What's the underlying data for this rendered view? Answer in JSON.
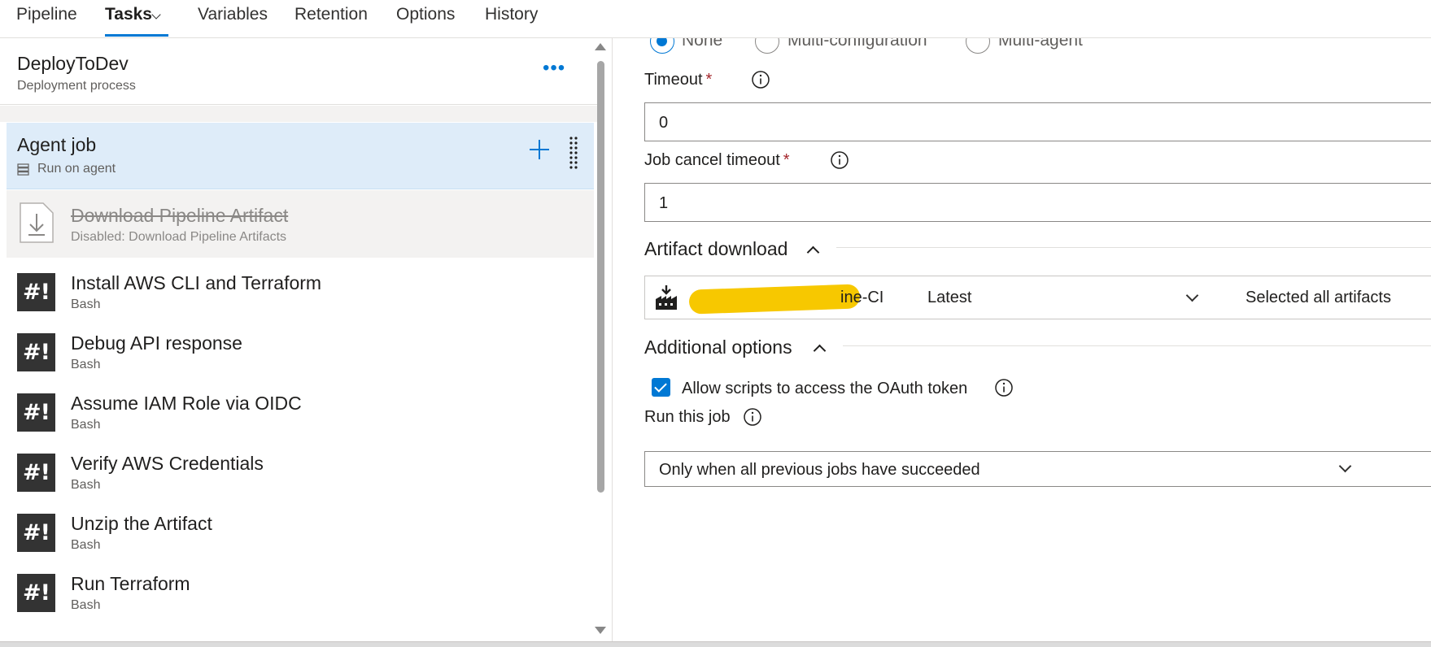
{
  "nav": {
    "tabs": [
      {
        "label": "Pipeline"
      },
      {
        "label": "Tasks"
      },
      {
        "label": "Variables"
      },
      {
        "label": "Retention"
      },
      {
        "label": "Options"
      },
      {
        "label": "History"
      }
    ],
    "active_tab": "Tasks",
    "accent_color": "#0078d4"
  },
  "stage": {
    "title": "DeployToDev",
    "subtitle": "Deployment process",
    "more_label": "•••"
  },
  "agent_job": {
    "title": "Agent job",
    "subtitle": "Run on agent"
  },
  "tasks": [
    {
      "name": "Download Pipeline Artifact",
      "subtitle": "Disabled: Download Pipeline Artifacts",
      "icon": "download-icon",
      "disabled": true
    },
    {
      "name": "Install AWS CLI and Terraform",
      "subtitle": "Bash",
      "icon": "bash-icon",
      "glyph": "#!"
    },
    {
      "name": "Debug API response",
      "subtitle": "Bash",
      "icon": "bash-icon",
      "glyph": "#!"
    },
    {
      "name": "Assume IAM Role via OIDC",
      "subtitle": "Bash",
      "icon": "bash-icon",
      "glyph": "#!"
    },
    {
      "name": "Verify AWS Credentials",
      "subtitle": "Bash",
      "icon": "bash-icon",
      "glyph": "#!"
    },
    {
      "name": "Unzip the Artifact",
      "subtitle": "Bash",
      "icon": "bash-icon",
      "glyph": "#!"
    },
    {
      "name": "Run Terraform",
      "subtitle": "Bash",
      "icon": "bash-icon",
      "glyph": "#!"
    }
  ],
  "parallelism": {
    "options": [
      "None",
      "Multi-configuration",
      "Multi-agent"
    ],
    "selected": "None"
  },
  "timeout": {
    "label": "Timeout",
    "required_mark": "*",
    "value": "0"
  },
  "cancel_timeout": {
    "label": "Job cancel timeout",
    "required_mark": "*",
    "value": "1"
  },
  "artifact_download": {
    "section_title": "Artifact download",
    "artifact_name": "ine-CI",
    "version": "Latest",
    "selection": "Selected all artifacts"
  },
  "additional_options": {
    "section_title": "Additional options",
    "oauth_label": "Allow scripts to access the OAuth token",
    "oauth_checked": true,
    "run_job_label": "Run this job",
    "run_condition": "Only when all previous jobs have succeeded"
  }
}
